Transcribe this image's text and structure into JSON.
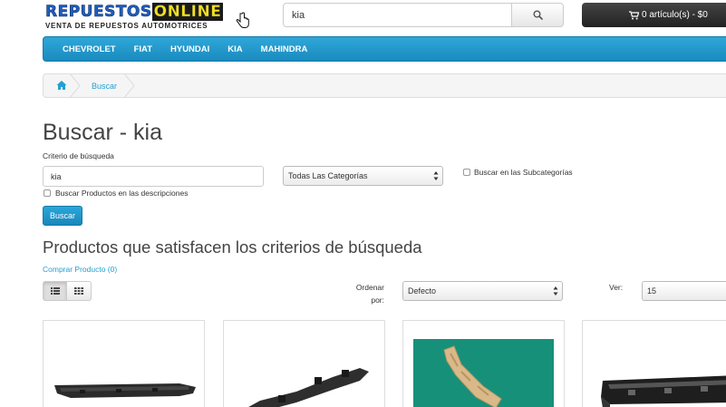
{
  "header": {
    "logo_word1": "REPUESTOS",
    "logo_word2": "ONLINE",
    "logo_tagline": "VENTA DE REPUESTOS AUTOMOTRICES",
    "search_value": "kia",
    "cart_label": "0 artículo(s) - $0"
  },
  "nav": {
    "items": [
      {
        "label": "CHEVROLET"
      },
      {
        "label": "FIAT"
      },
      {
        "label": "HYUNDAI"
      },
      {
        "label": "KIA"
      },
      {
        "label": "MAHINDRA"
      }
    ]
  },
  "breadcrumb": {
    "current": "Buscar"
  },
  "search_page": {
    "title": "Buscar - kia",
    "criteria_label": "Criterio de búsqueda",
    "criteria_value": "kia",
    "category_selected": "Todas Las Categorías",
    "subcategories_label": "Buscar en las Subcategorías",
    "descriptions_label": "Buscar Productos en las descripciones",
    "search_button": "Buscar"
  },
  "results": {
    "title": "Productos que satisfacen los criterios de búsqueda",
    "compare_link": "Comprar Producto (0)",
    "sort_label_1": "Ordenar",
    "sort_label_2": "por:",
    "sort_selected": "Defecto",
    "limit_label": "Ver:",
    "limit_selected": "15"
  },
  "icons": {
    "search": "search-icon",
    "cart": "cart-icon",
    "home": "home-icon",
    "list_view": "list-icon",
    "grid_view": "grid-icon"
  },
  "colors": {
    "accent": "#23a1d1",
    "nav_bg": "#2fa7d8",
    "cart_bg": "#2c2c2c",
    "logo_blue": "#1f5fbf",
    "logo_yellow": "#f4e21c",
    "product3_bg": "#17907a"
  }
}
